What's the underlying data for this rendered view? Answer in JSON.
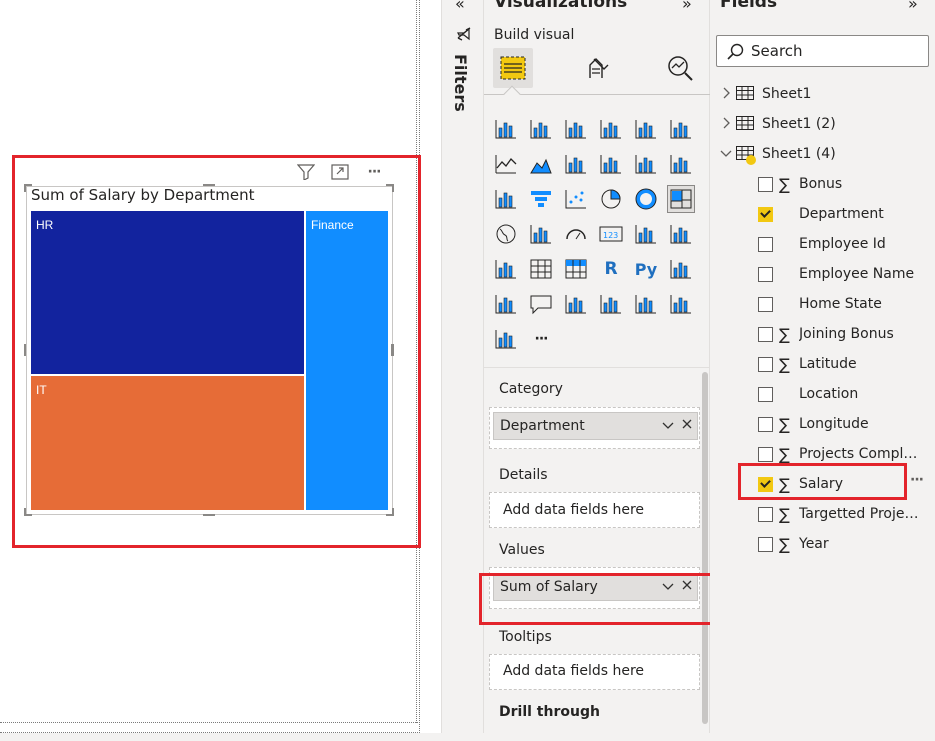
{
  "visual": {
    "title": "Sum of Salary by Department",
    "toolbar": [
      "filter-icon",
      "focus-mode-icon",
      "more-options-icon"
    ],
    "more_label": "···",
    "tiles": [
      {
        "label": "HR",
        "color": "#12239e"
      },
      {
        "label": "IT",
        "color": "#e66c37"
      },
      {
        "label": "Finance",
        "color": "#118dff"
      }
    ]
  },
  "filters": {
    "label": "Filters"
  },
  "visualizations": {
    "title": "Visualizations",
    "build_visual_label": "Build visual",
    "tabs": [
      "build-visual-icon",
      "format-visual-icon",
      "analytics-icon"
    ],
    "more_visuals_label": "···",
    "wells": {
      "category": {
        "label": "Category",
        "field": "Department"
      },
      "details": {
        "label": "Details",
        "placeholder": "Add data fields here"
      },
      "values": {
        "label": "Values",
        "field": "Sum of Salary"
      },
      "tooltips": {
        "label": "Tooltips",
        "placeholder": "Add data fields here"
      },
      "drill_through": {
        "label": "Drill through"
      }
    }
  },
  "fields": {
    "title": "Fields",
    "search_placeholder": "Search",
    "tables": [
      {
        "name": "Sheet1",
        "expanded": false
      },
      {
        "name": "Sheet1 (2)",
        "expanded": false
      },
      {
        "name": "Sheet1 (4)",
        "expanded": true
      }
    ],
    "items": [
      {
        "name": "Bonus",
        "sigma": true,
        "checked": false
      },
      {
        "name": "Department",
        "sigma": false,
        "checked": true
      },
      {
        "name": "Employee Id",
        "sigma": false,
        "checked": false
      },
      {
        "name": "Employee Name",
        "sigma": false,
        "checked": false
      },
      {
        "name": "Home State",
        "sigma": false,
        "checked": false
      },
      {
        "name": "Joining Bonus",
        "sigma": true,
        "checked": false
      },
      {
        "name": "Latitude",
        "sigma": true,
        "checked": false
      },
      {
        "name": "Location",
        "sigma": false,
        "checked": false
      },
      {
        "name": "Longitude",
        "sigma": true,
        "checked": false
      },
      {
        "name": "Projects Completed",
        "sigma": true,
        "checked": false
      },
      {
        "name": "Salary",
        "sigma": true,
        "checked": true
      },
      {
        "name": "Targetted Projects",
        "sigma": true,
        "checked": false
      },
      {
        "name": "Year",
        "sigma": true,
        "checked": false
      }
    ],
    "more_label": "···"
  },
  "colors": {
    "highlight": "#e3242b",
    "accent": "#f2c811"
  }
}
